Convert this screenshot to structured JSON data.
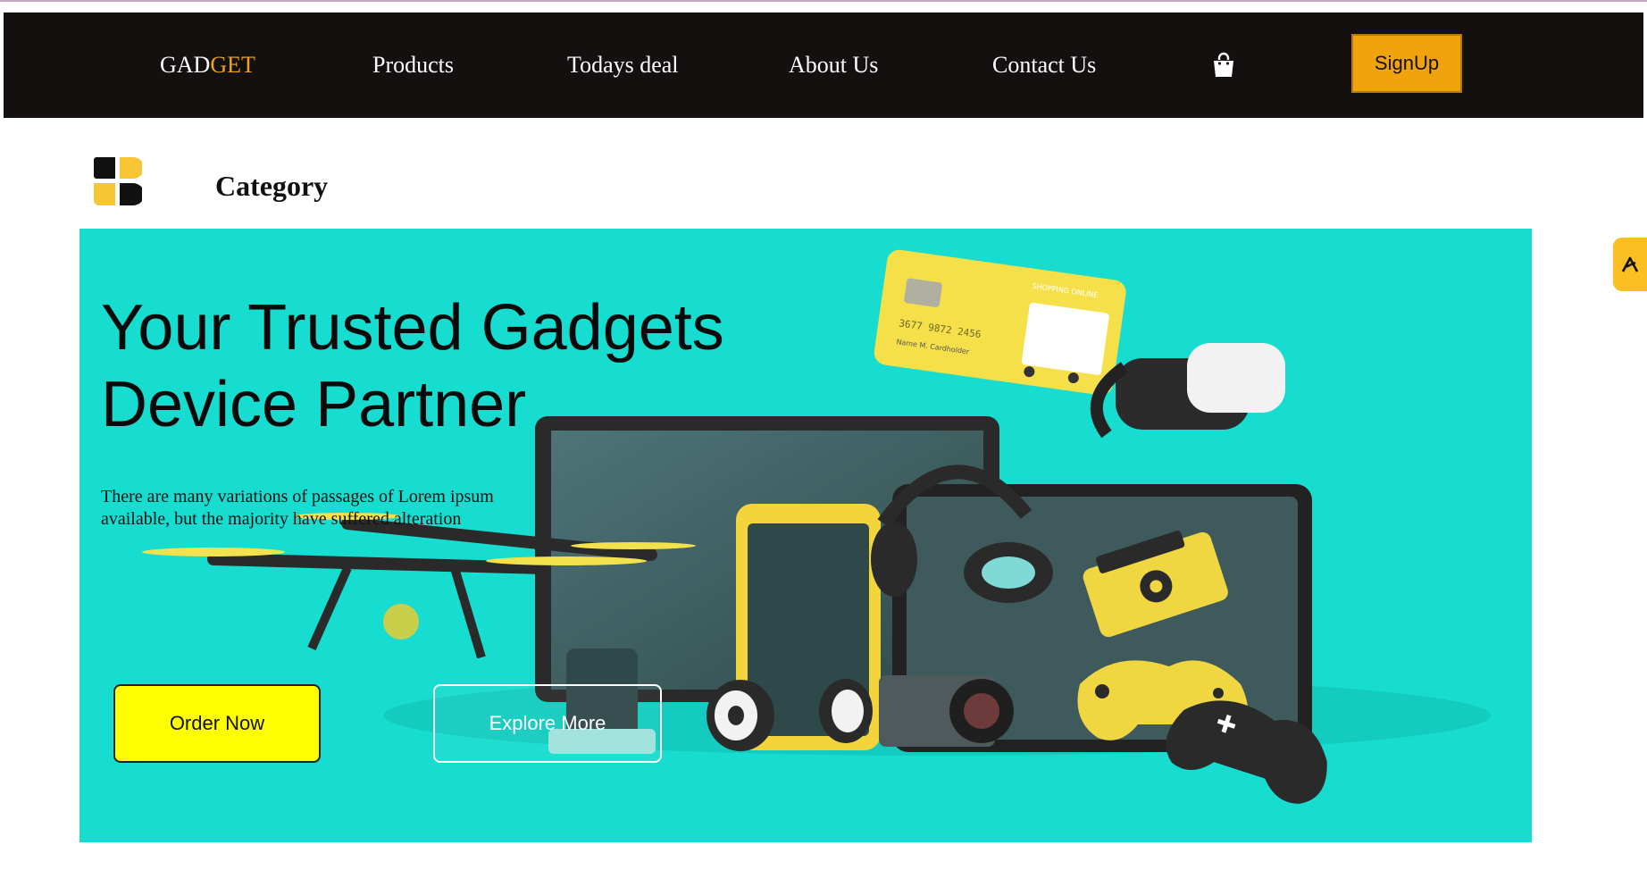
{
  "nav": {
    "brand_part1": "GAD",
    "brand_part2": "GET",
    "links": [
      "Products",
      "Todays deal",
      "About Us",
      "Contact Us"
    ],
    "cart_icon": "shopping-bag-icon",
    "signup_label": "SignUp"
  },
  "category": {
    "title": "Category",
    "icon": "category-grid-icon"
  },
  "hero": {
    "title_line1": "Your Trusted Gadgets",
    "title_line2": "Device Partner",
    "description": "There are many variations of passages of Lorem ipsum available, but the majority have suffered alteration",
    "order_label": "Order Now",
    "explore_label": "Explore More",
    "card_text": "SHOPPING ONLINE",
    "card_holder": "Name  M. Cardholder",
    "card_number": "3677 9872 2456"
  },
  "widget": {
    "icon": "accessibility-icon"
  },
  "colors": {
    "nav_bg": "#141010",
    "accent": "#f0a30a",
    "hero_bg": "#17dcd0",
    "order_button": "#ffff00"
  }
}
